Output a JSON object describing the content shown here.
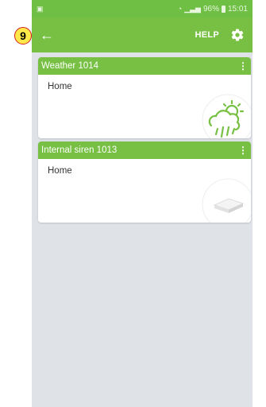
{
  "status_bar": {
    "battery_level": "96%",
    "time": "15:01"
  },
  "toolbar": {
    "help_label": "HELP"
  },
  "devices": [
    {
      "title": "Weather 1014",
      "location": "Home",
      "icon": "weather-icon"
    },
    {
      "title": "Internal siren 1013",
      "location": "Home",
      "icon": "siren-icon"
    }
  ],
  "annotation": {
    "step_number": "9"
  },
  "colors": {
    "accent": "#77c043",
    "annotation_fill": "#ffe94a",
    "annotation_border": "#d31f1f"
  }
}
